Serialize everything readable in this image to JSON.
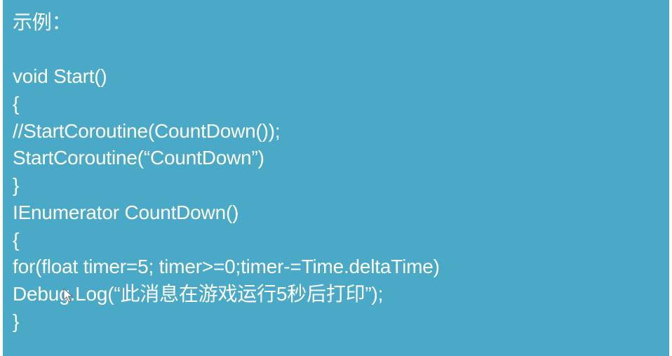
{
  "slide": {
    "lines": [
      "示例：",
      "",
      "void Start()",
      "{",
      "//StartCoroutine(CountDown());",
      "StartCoroutine(“CountDown”)",
      "}",
      "IEnumerator CountDown()",
      "{",
      "for(float timer=5; timer>=0;timer-=Time.deltaTime)",
      "Debug.Log(“此消息在游戏运行5秒后打印”);",
      "}"
    ]
  },
  "colors": {
    "slide_background": "#4aa9c6",
    "text": "#ffffff"
  },
  "icons": {
    "cursor": "mouse-pointer-icon"
  }
}
